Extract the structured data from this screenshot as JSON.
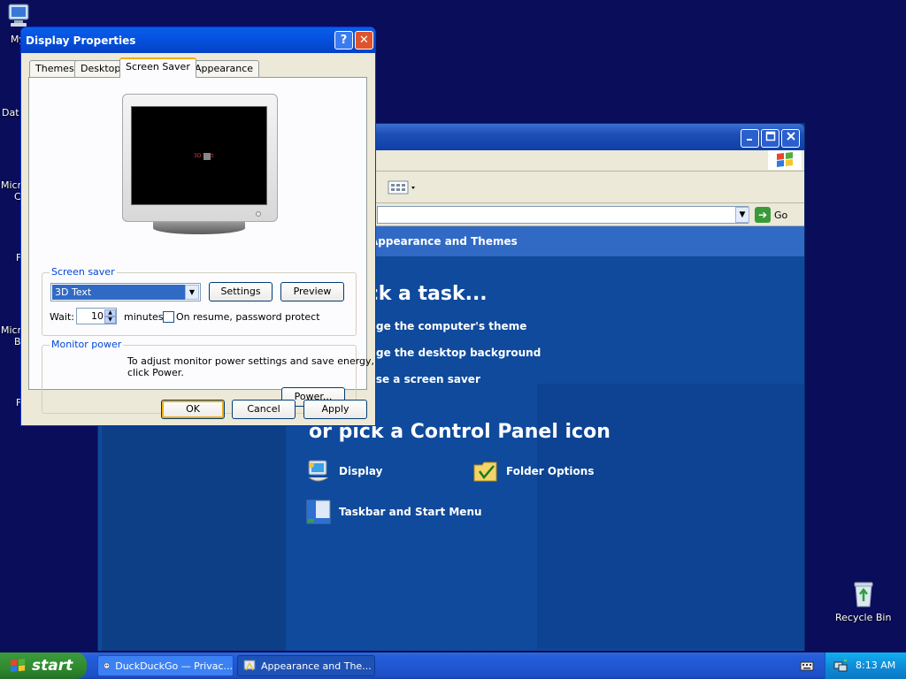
{
  "desktop": {
    "icons": [
      {
        "label": "My"
      },
      {
        "label": "Dat"
      },
      {
        "label": "Micro"
      },
      {
        "label": "C"
      },
      {
        "label": "F"
      },
      {
        "label": "Micro"
      },
      {
        "label": "B"
      },
      {
        "label": "F"
      }
    ],
    "recycle_bin": "Recycle Bin"
  },
  "explorer": {
    "address_go": "Go",
    "header": "Appearance and Themes",
    "task_heading": "Pick a task...",
    "tasks": [
      "Change the computer's theme",
      "Change the desktop background",
      "Choose a screen saver"
    ],
    "cp_heading": "or pick a Control Panel icon",
    "cp_icons": [
      "Display",
      "Folder Options",
      "Taskbar and Start Menu"
    ]
  },
  "dialog": {
    "title": "Display Properties",
    "help_glyph": "?",
    "close_glyph": "✕",
    "tabs": [
      "Themes",
      "Desktop",
      "Screen Saver",
      "Appearance"
    ],
    "active_tab": "Screen Saver",
    "preview_text": "3D Text",
    "screen_saver": {
      "legend": "Screen saver",
      "selected": "3D Text",
      "settings_label": "Settings",
      "preview_label": "Preview",
      "wait_label": "Wait:",
      "wait_value": "10",
      "minutes_label": "minutes",
      "password_label": "On resume, password protect",
      "password_checked": false
    },
    "monitor_power": {
      "legend": "Monitor power",
      "description_line1": "To adjust monitor power settings and save energy,",
      "description_line2": "click Power.",
      "power_label": "Power..."
    },
    "ok_label": "OK",
    "cancel_label": "Cancel",
    "apply_label": "Apply"
  },
  "taskbar": {
    "start_label": "start",
    "tasks": [
      {
        "label": "DuckDuckGo — Privac...",
        "active": false
      },
      {
        "label": "Appearance and The...",
        "active": true
      }
    ],
    "clock": "8:13 AM"
  },
  "colors": {
    "desktop": "#0a0d5a",
    "dialog_title": "#0553e1",
    "taskbar": "#245edb",
    "start": "#2f8a2f"
  }
}
